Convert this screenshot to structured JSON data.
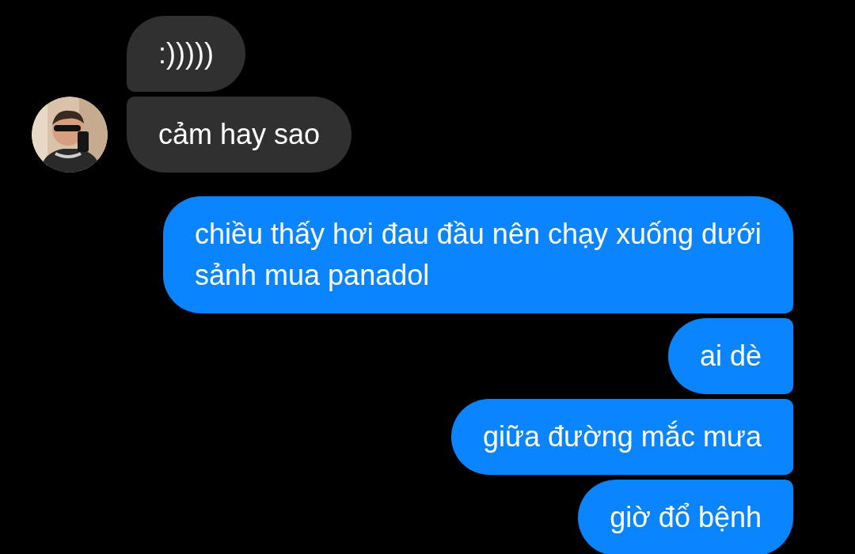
{
  "groups": [
    {
      "kind": "incoming",
      "messages": [
        ":)))))",
        "cảm hay sao"
      ]
    },
    {
      "kind": "outgoing",
      "messages": [
        "chiều thấy hơi đau đầu nên chạy xuống dưới sảnh mua panadol",
        "ai dè",
        "giữa đường mắc mưa",
        "giờ đổ bệnh"
      ]
    }
  ]
}
